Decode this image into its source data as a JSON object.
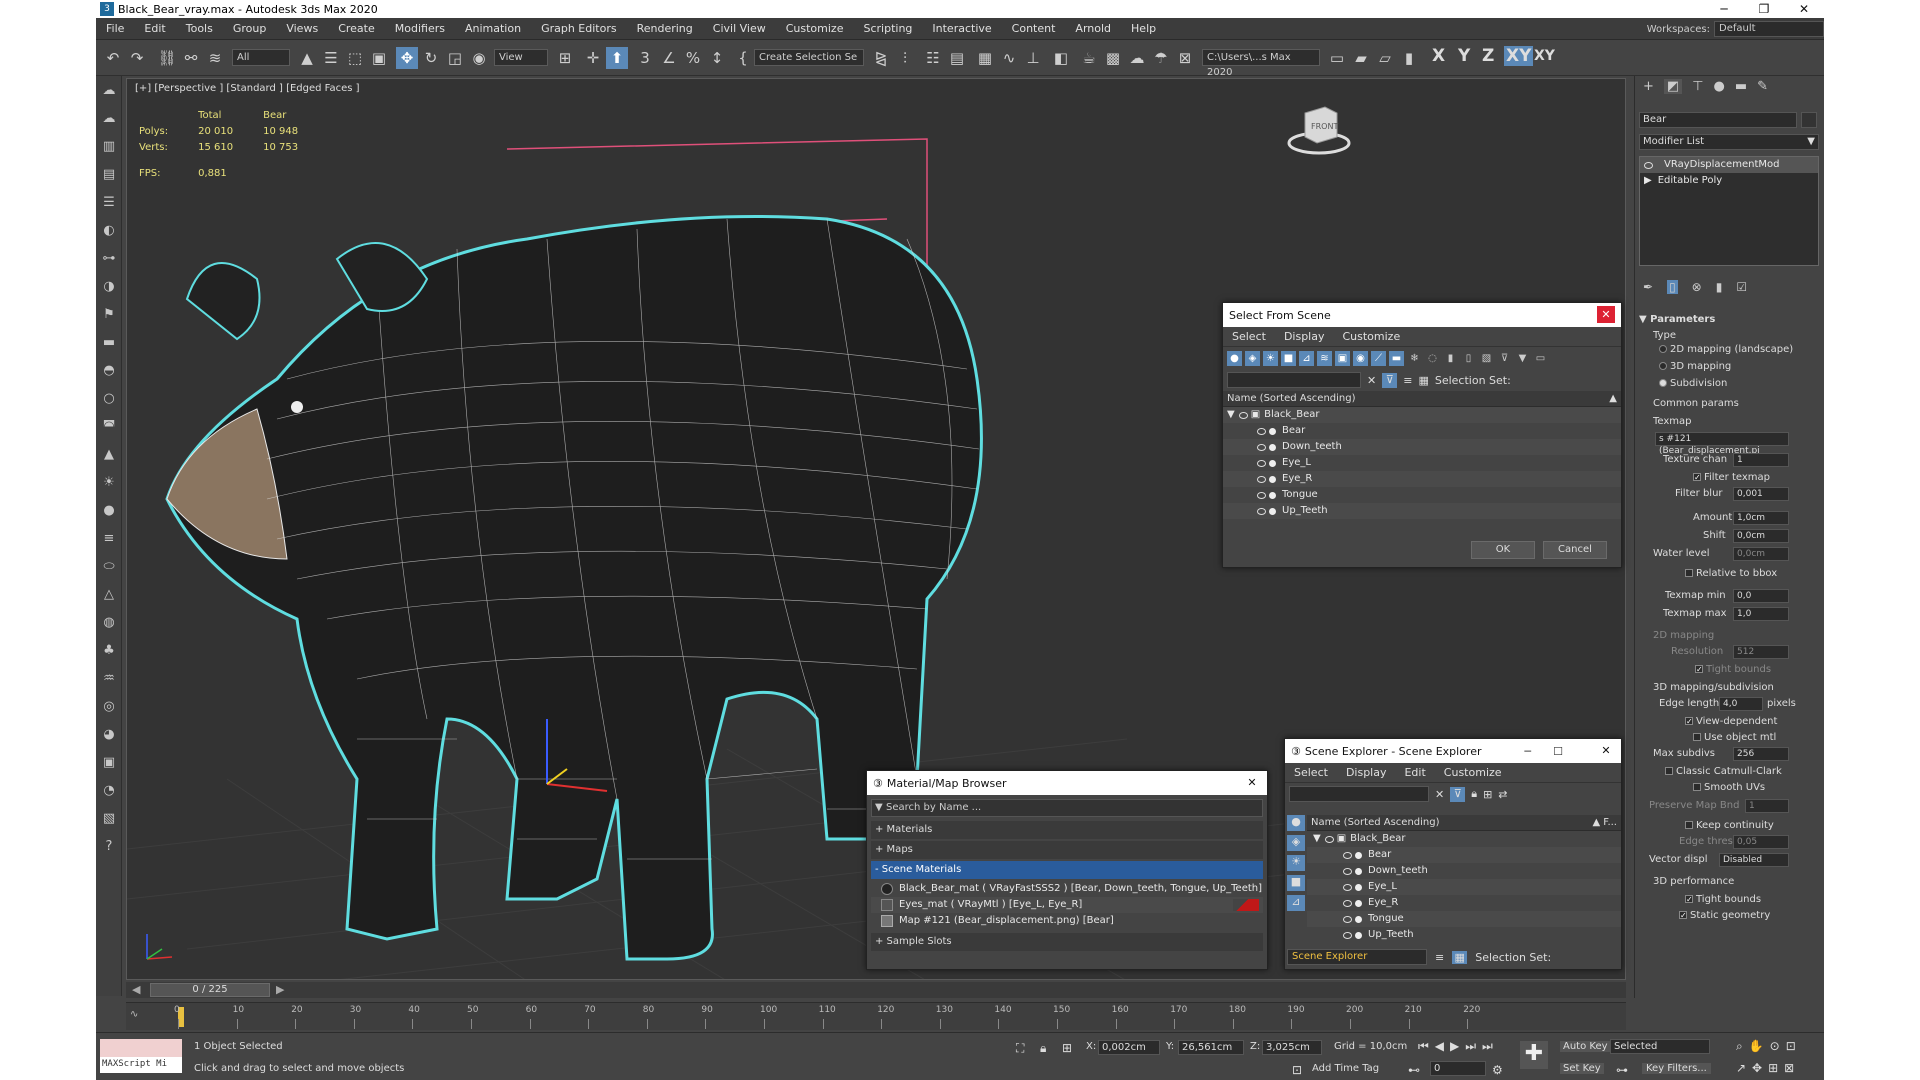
{
  "window": {
    "title": "Black_Bear_vray.max - Autodesk 3ds Max 2020",
    "app_icon": "3"
  },
  "menu": {
    "items": [
      "File",
      "Edit",
      "Tools",
      "Group",
      "Views",
      "Create",
      "Modifiers",
      "Animation",
      "Graph Editors",
      "Rendering",
      "Civil View",
      "Customize",
      "Scripting",
      "Interactive",
      "Content",
      "Arnold",
      "Help"
    ],
    "workspace_label": "Workspaces:",
    "workspace_value": "Default"
  },
  "toolbar": {
    "filter": "All",
    "view": "View",
    "selection_set": "Create Selection Se",
    "path": "C:\\Users\\...s Max 2020",
    "axes": [
      "X",
      "Y",
      "Z",
      "XY",
      "XY"
    ]
  },
  "viewport": {
    "label": "[+] [Perspective ] [Standard ] [Edged Faces ]",
    "stats": {
      "col_total": "Total",
      "col_bear": "Bear",
      "polys_label": "Polys:",
      "polys_total": "20 010",
      "polys_bear": "10 948",
      "verts_label": "Verts:",
      "verts_total": "15 610",
      "verts_bear": "10 753",
      "fps_label": "FPS:",
      "fps_value": "0,881"
    },
    "viewcube_label": "FRONT",
    "accent": "#5fdde0"
  },
  "select_from_scene": {
    "title": "Select From Scene",
    "menu": [
      "Select",
      "Display",
      "Customize"
    ],
    "selection_set_label": "Selection Set:",
    "column": "Name (Sorted Ascending)",
    "root": "Black_Bear",
    "items": [
      "Bear",
      "Down_teeth",
      "Eye_L",
      "Eye_R",
      "Tongue",
      "Up_Teeth"
    ],
    "ok": "OK",
    "cancel": "Cancel"
  },
  "material_browser": {
    "title": "Material/Map Browser",
    "search": "Search by Name ...",
    "sections": [
      "+ Materials",
      "+ Maps",
      "- Scene Materials",
      "+ Sample Slots"
    ],
    "materials": [
      "Black_Bear_mat  ( VRayFastSSS2 )  [Bear, Down_teeth, Tongue, Up_Teeth]",
      "Eyes_mat  ( VRayMtl )  [Eye_L, Eye_R]",
      "Map #121 (Bear_displacement.png)  [Bear]"
    ]
  },
  "scene_explorer": {
    "title": "Scene Explorer - Scene Explorer",
    "menu": [
      "Select",
      "Display",
      "Edit",
      "Customize"
    ],
    "column": "Name (Sorted Ascending)",
    "column_right": "▲ F...",
    "root": "Black_Bear",
    "items": [
      "Bear",
      "Down_teeth",
      "Eye_L",
      "Eye_R",
      "Tongue",
      "Up_Teeth"
    ],
    "footer": "Scene Explorer",
    "selection_set_label": "Selection Set:"
  },
  "command_panel": {
    "object_name": "Bear",
    "modifier_list": "Modifier List",
    "stack": [
      "VRayDisplacementMod",
      "Editable Poly"
    ],
    "parameters": "Parameters",
    "type_label": "Type",
    "types": [
      "2D mapping (landscape)",
      "3D mapping",
      "Subdivision"
    ],
    "common_params": "Common params",
    "texmap_label": "Texmap",
    "texmap_value": "s #121 (Bear_displacement.pi",
    "texture_chan_label": "Texture chan",
    "texture_chan": "1",
    "filter_texmap": "Filter texmap",
    "filter_blur_label": "Filter blur",
    "filter_blur": "0,001",
    "amount_label": "Amount",
    "amount": "1,0cm",
    "shift_label": "Shift",
    "shift": "0,0cm",
    "water_level_label": "Water level",
    "water_level": "0,0cm",
    "relative_bbox": "Relative to bbox",
    "texmap_min_label": "Texmap min",
    "texmap_min": "0,0",
    "texmap_max_label": "Texmap max",
    "texmap_max": "1,0",
    "mapping2d": "2D mapping",
    "resolution_label": "Resolution",
    "resolution": "512",
    "tight_bounds": "Tight bounds",
    "mapping3d": "3D mapping/subdivision",
    "edge_length_label": "Edge length",
    "edge_length": "4,0",
    "pixels": "pixels",
    "view_dependent": "View-dependent",
    "use_object_mtl": "Use object mtl",
    "max_subdivs_label": "Max subdivs",
    "max_subdivs": "256",
    "classic_catmull": "Classic Catmull-Clark",
    "smooth_uvs": "Smooth UVs",
    "preserve_map_label": "Preserve Map Bnd",
    "preserve_map": "1",
    "keep_continuity": "Keep continuity",
    "edge_thresh_label": "Edge thresh",
    "edge_thresh": "0,05",
    "vector_disp_label": "Vector displ",
    "vector_disp": "Disabled",
    "performance": "3D performance",
    "tight_bounds2": "Tight bounds",
    "static_geometry": "Static geometry"
  },
  "timeline": {
    "frame": "0 / 225",
    "ticks": [
      "0",
      "10",
      "20",
      "30",
      "40",
      "50",
      "60",
      "70",
      "80",
      "90",
      "100",
      "110",
      "120",
      "130",
      "140",
      "150",
      "160",
      "170",
      "180",
      "190",
      "200",
      "210",
      "220"
    ]
  },
  "status": {
    "maxscript": "MAXScript Mi",
    "selected": "1 Object Selected",
    "hint": "Click and drag to select and move objects",
    "x_label": "X:",
    "x": "0,002cm",
    "y_label": "Y:",
    "y": "26,561cm",
    "z_label": "Z:",
    "z": "3,025cm",
    "grid": "Grid = 10,0cm",
    "add_time_tag": "Add Time Tag",
    "auto_key": "Auto Key",
    "selected_dd": "Selected",
    "set_key": "Set Key",
    "key_filters": "Key Filters...",
    "frame_field": "0"
  }
}
